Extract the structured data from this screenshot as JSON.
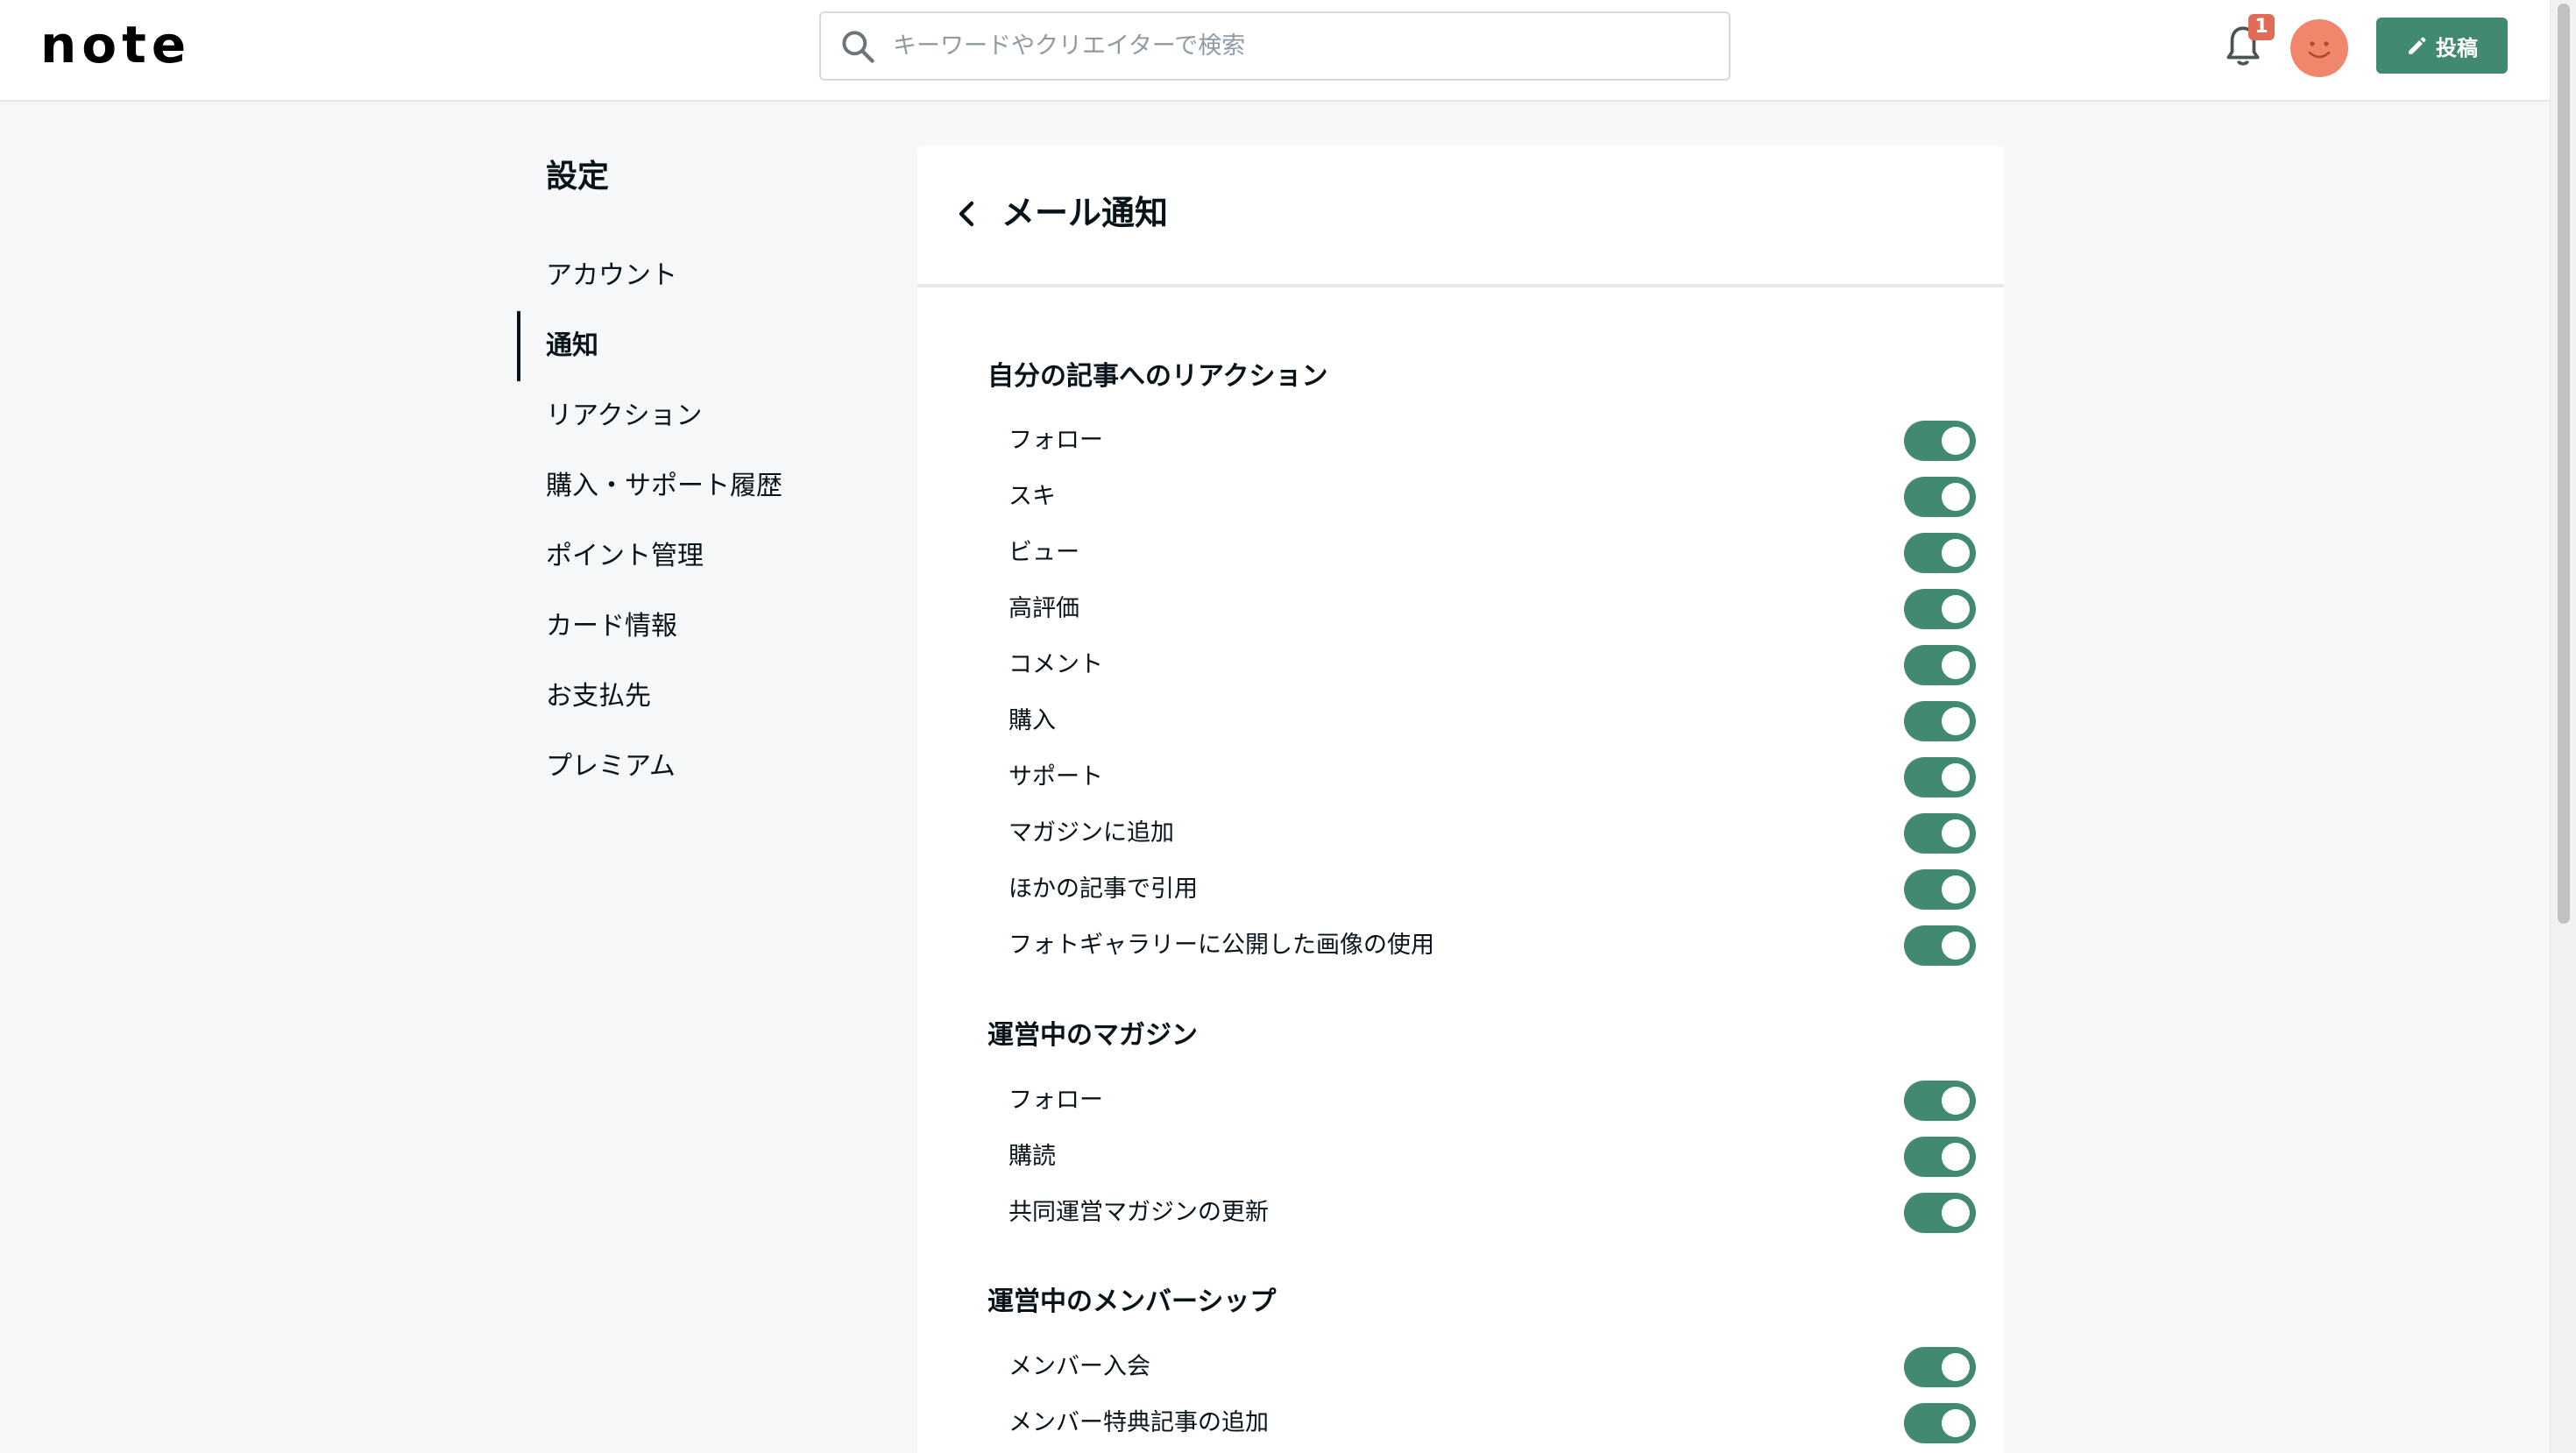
{
  "header": {
    "logo": "note",
    "search_placeholder": "キーワードやクリエイターで検索",
    "notification_count": "1",
    "post_label": "投稿"
  },
  "sidebar": {
    "title": "設定",
    "items": [
      {
        "label": "アカウント",
        "active": false
      },
      {
        "label": "通知",
        "active": true
      },
      {
        "label": "リアクション",
        "active": false
      },
      {
        "label": "購入・サポート履歴",
        "active": false
      },
      {
        "label": "ポイント管理",
        "active": false
      },
      {
        "label": "カード情報",
        "active": false
      },
      {
        "label": "お支払先",
        "active": false
      },
      {
        "label": "プレミアム",
        "active": false
      }
    ]
  },
  "panel": {
    "title": "メール通知",
    "sections": [
      {
        "title": "自分の記事へのリアクション",
        "items": [
          {
            "label": "フォロー",
            "on": true
          },
          {
            "label": "スキ",
            "on": true
          },
          {
            "label": "ビュー",
            "on": true
          },
          {
            "label": "高評価",
            "on": true
          },
          {
            "label": "コメント",
            "on": true
          },
          {
            "label": "購入",
            "on": true
          },
          {
            "label": "サポート",
            "on": true
          },
          {
            "label": "マガジンに追加",
            "on": true
          },
          {
            "label": "ほかの記事で引用",
            "on": true
          },
          {
            "label": "フォトギャラリーに公開した画像の使用",
            "on": true
          }
        ]
      },
      {
        "title": "運営中のマガジン",
        "items": [
          {
            "label": "フォロー",
            "on": true
          },
          {
            "label": "購読",
            "on": true
          },
          {
            "label": "共同運営マガジンの更新",
            "on": true
          }
        ]
      },
      {
        "title": "運営中のメンバーシップ",
        "items": [
          {
            "label": "メンバー入会",
            "on": true
          },
          {
            "label": "メンバー特典記事の追加",
            "on": true
          }
        ]
      }
    ]
  },
  "colors": {
    "accent": "#41896f",
    "badge": "#e06b56",
    "avatar": "#f0866c",
    "background": "#f5f7f8"
  }
}
